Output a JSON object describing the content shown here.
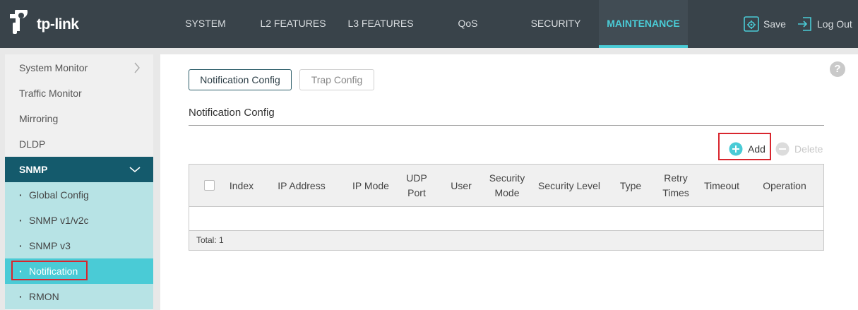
{
  "brand": {
    "logo_text": "tp-link"
  },
  "nav": {
    "items": [
      {
        "label": "SYSTEM"
      },
      {
        "label": "L2 FEATURES"
      },
      {
        "label": "L3 FEATURES"
      },
      {
        "label": "QoS"
      },
      {
        "label": "SECURITY"
      },
      {
        "label": "MAINTENANCE"
      }
    ],
    "active": "MAINTENANCE",
    "save_label": "Save",
    "logout_label": "Log Out"
  },
  "sidebar": {
    "items": [
      {
        "label": "System Monitor"
      },
      {
        "label": "Traffic Monitor"
      },
      {
        "label": "Mirroring"
      },
      {
        "label": "DLDP"
      }
    ],
    "group": {
      "label": "SNMP"
    },
    "sub_items": [
      {
        "label": "Global Config"
      },
      {
        "label": "SNMP v1/v2c"
      },
      {
        "label": "SNMP v3"
      },
      {
        "label": "Notification"
      },
      {
        "label": "RMON"
      }
    ],
    "active_sub": "Notification"
  },
  "content": {
    "help": "?",
    "tabs": [
      {
        "label": "Notification Config"
      },
      {
        "label": "Trap Config"
      }
    ],
    "section_title": "Notification Config",
    "add_label": "Add",
    "delete_label": "Delete",
    "table": {
      "columns": [
        "Index",
        "IP Address",
        "IP Mode",
        "UDP Port",
        "User",
        "Security Mode",
        "Security Level",
        "Type",
        "Retry Times",
        "Timeout",
        "Operation"
      ],
      "footer": "Total: 1"
    }
  },
  "colors": {
    "topbar": "#39434a",
    "accent": "#4acbd6",
    "sidebar_group": "#145a6c",
    "sidebar_sub": "#b7e3e5",
    "highlight_box": "#d8262e"
  }
}
